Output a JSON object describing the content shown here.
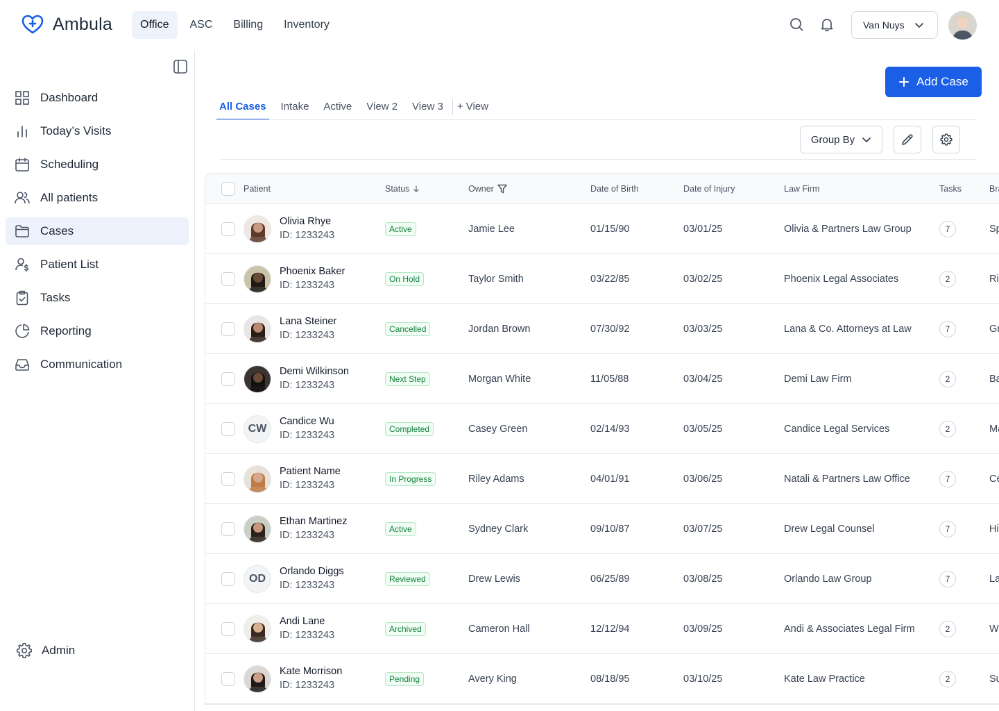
{
  "app": {
    "name": "Ambula"
  },
  "topnav": {
    "items": [
      "Office",
      "ASC",
      "Billing",
      "Inventory"
    ],
    "active": "Office"
  },
  "location": {
    "selected": "Van Nuys"
  },
  "sidebar": {
    "items": [
      "Dashboard",
      "Today’s Visits",
      "Scheduling",
      "All patients",
      "Cases",
      "Patient List",
      "Tasks",
      "Reporting",
      "Communication"
    ],
    "active": "Cases",
    "admin_label": "Admin"
  },
  "toolbar": {
    "add_case_label": "Add Case",
    "group_by_label": "Group By"
  },
  "tabs": {
    "items": [
      "All Cases",
      "Intake",
      "Active",
      "View 2",
      "View 3"
    ],
    "active": "All Cases",
    "add_label": "+ View"
  },
  "table": {
    "columns": {
      "patient": "Patient",
      "status": "Status",
      "owner": "Owner",
      "dob": "Date of Birth",
      "doi": "Date of Injury",
      "law_firm": "Law Firm",
      "tasks": "Tasks",
      "branch": "Bra"
    },
    "rows": [
      {
        "name": "Olivia Rhye",
        "id": "ID: 1233243",
        "avatar": "photo",
        "status": "Active",
        "owner": "Jamie Lee",
        "dob": "01/15/90",
        "doi": "03/01/25",
        "law_firm": "Olivia & Partners Law Group",
        "tasks": "7",
        "branch": "Sp"
      },
      {
        "name": "Phoenix Baker",
        "id": "ID: 1233243",
        "avatar": "photo",
        "status": "On Hold",
        "owner": "Taylor Smith",
        "dob": "03/22/85",
        "doi": "03/02/25",
        "law_firm": "Phoenix Legal Associates",
        "tasks": "2",
        "branch": "Riv"
      },
      {
        "name": "Lana Steiner",
        "id": "ID: 1233243",
        "avatar": "photo",
        "status": "Cancelled",
        "owner": "Jordan Brown",
        "dob": "07/30/92",
        "doi": "03/03/25",
        "law_firm": "Lana & Co. Attorneys at Law",
        "tasks": "7",
        "branch": "Gr"
      },
      {
        "name": "Demi Wilkinson",
        "id": "ID: 1233243",
        "avatar": "photo",
        "status": "Next Step",
        "owner": "Morgan White",
        "dob": "11/05/88",
        "doi": "03/04/25",
        "law_firm": "Demi Law Firm",
        "tasks": "2",
        "branch": "Ba"
      },
      {
        "name": "Candice Wu",
        "id": "ID: 1233243",
        "avatar": "initials",
        "initials": "CW",
        "status": "Completed",
        "owner": "Casey Green",
        "dob": "02/14/93",
        "doi": "03/05/25",
        "law_firm": "Candice Legal Services",
        "tasks": "2",
        "branch": "Ma"
      },
      {
        "name": "Patient Name",
        "id": "ID: 1233243",
        "avatar": "photo",
        "status": "In Progress",
        "owner": "Riley Adams",
        "dob": "04/01/91",
        "doi": "03/06/25",
        "law_firm": "Natali & Partners Law Office",
        "tasks": "7",
        "branch": "Ce"
      },
      {
        "name": "Ethan Martinez",
        "id": "ID: 1233243",
        "avatar": "photo",
        "status": "Active",
        "owner": "Sydney Clark",
        "dob": "09/10/87",
        "doi": "03/07/25",
        "law_firm": "Drew Legal Counsel",
        "tasks": "7",
        "branch": "Hi"
      },
      {
        "name": "Orlando Diggs",
        "id": "ID: 1233243",
        "avatar": "initials",
        "initials": "OD",
        "status": "Reviewed",
        "owner": "Drew Lewis",
        "dob": "06/25/89",
        "doi": "03/08/25",
        "law_firm": "Orlando Law Group",
        "tasks": "7",
        "branch": "La"
      },
      {
        "name": "Andi Lane",
        "id": "ID: 1233243",
        "avatar": "photo",
        "status": "Archived",
        "owner": "Cameron Hall",
        "dob": "12/12/94",
        "doi": "03/09/25",
        "law_firm": "Andi & Associates Legal Firm",
        "tasks": "2",
        "branch": "We"
      },
      {
        "name": "Kate Morrison",
        "id": "ID: 1233243",
        "avatar": "photo",
        "status": "Pending",
        "owner": "Avery King",
        "dob": "08/18/95",
        "doi": "03/10/25",
        "law_firm": "Kate Law Practice",
        "tasks": "2",
        "branch": "Su"
      }
    ]
  },
  "colors": {
    "accent": "#1b5fe6",
    "status_text": "#15803d",
    "status_bg": "#f0fdf4",
    "active_nav_bg": "#edf1fb"
  },
  "icons": {
    "logo": "heart-plus-icon",
    "top": [
      "search-icon",
      "bell-icon",
      "chevron-down-icon"
    ],
    "sidebar": [
      "grid-icon",
      "bar-chart-icon",
      "calendar-icon",
      "users-icon",
      "folder-icon",
      "user-dollar-icon",
      "clipboard-check-icon",
      "pie-chart-icon",
      "inbox-icon"
    ],
    "toolbar": [
      "plus-icon",
      "chevron-down-icon",
      "pencil-icon",
      "gear-icon"
    ],
    "table": [
      "sort-down-icon",
      "filter-icon"
    ]
  }
}
